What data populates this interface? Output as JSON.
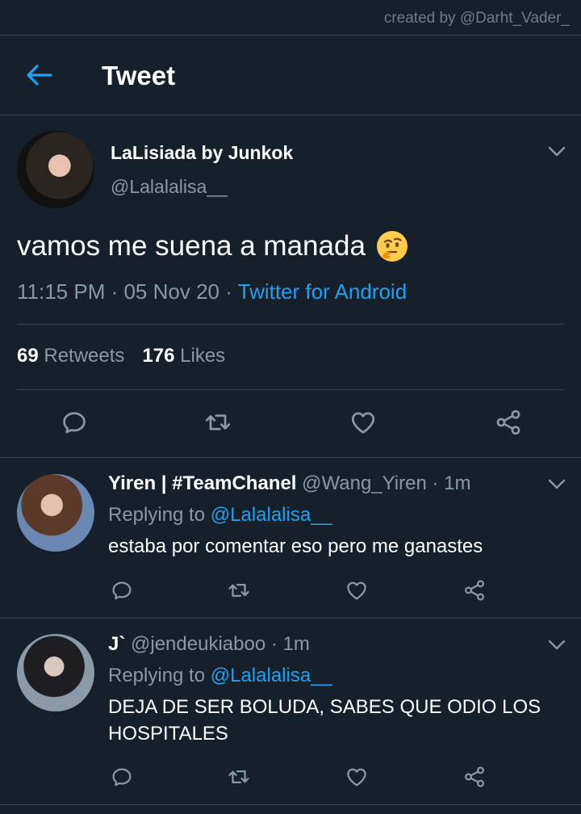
{
  "credit": "created by @Darht_Vader_",
  "header": {
    "title": "Tweet",
    "back_icon": "arrow-left-icon"
  },
  "tweet": {
    "author_name": "LaLisiada by Junkok",
    "author_handle": "@Lalalalisa__",
    "text": "vamos me suena a manada",
    "emoji": "thinking-face",
    "time": "11:15 PM · 05 Nov 20 · ",
    "source": "Twitter for Android",
    "retweets": "69",
    "retweets_label": "Retweets",
    "likes": "176",
    "likes_label": "Likes"
  },
  "replies": [
    {
      "name": "Yiren | #TeamChanel",
      "handle": "@Wang_Yiren · 1m",
      "replying_prefix": "Replying to ",
      "replying_to": "@Lalalalisa__",
      "text": "estaba por comentar eso pero me ganastes"
    },
    {
      "name": "J`",
      "handle": "@jendeukiaboo · 1m",
      "replying_prefix": "Replying to ",
      "replying_to": "@Lalalalisa__",
      "text": "DEJA DE SER BOLUDA, SABES QUE ODIO LOS HOSPITALES"
    }
  ],
  "colors": {
    "background": "#15202b",
    "accent": "#1da1f2",
    "muted": "#8899a6",
    "divider": "#38444d"
  }
}
